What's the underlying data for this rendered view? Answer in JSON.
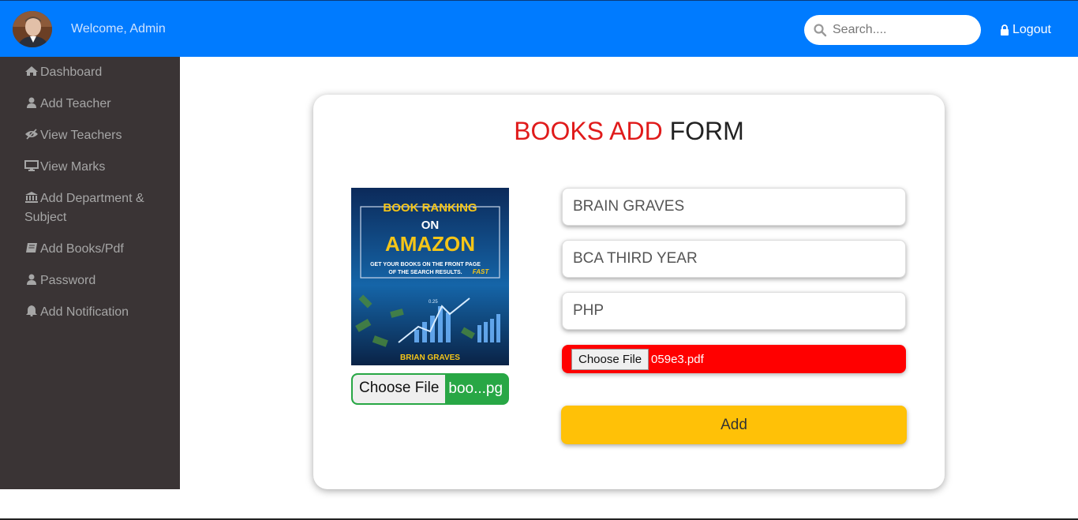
{
  "header": {
    "welcome": "Welcome, Admin",
    "search_placeholder": "Search....",
    "logout": "Logout"
  },
  "sidebar": {
    "items": [
      {
        "label": "Dashboard",
        "icon": "home-icon"
      },
      {
        "label": "Add Teacher",
        "icon": "user-icon"
      },
      {
        "label": "View Teachers",
        "icon": "eye-slash-icon"
      },
      {
        "label": "View Marks",
        "icon": "desktop-icon"
      },
      {
        "label": "Add Department & Subject",
        "icon": "university-icon"
      },
      {
        "label": "Add Books/Pdf",
        "icon": "book-icon"
      },
      {
        "label": "Password",
        "icon": "user-icon"
      },
      {
        "label": "Add Notification",
        "icon": "bell-icon"
      }
    ]
  },
  "form": {
    "title_part1": "BOOKS ADD",
    "title_part2": "FORM",
    "cover": {
      "title_line1": "BOOK RANKING",
      "title_line2": "ON",
      "title_line3": "AMAZON",
      "tagline1": "GET YOUR BOOKS ON THE FRONT PAGE",
      "tagline2": "OF THE SEARCH RESULTS.",
      "tagline_fast": "FAST",
      "author": "BRIAN GRAVES",
      "axis_label": "0.25"
    },
    "image_file": {
      "button": "Choose File",
      "filename": "boo...pg"
    },
    "fields": [
      {
        "value": "BRAIN GRAVES"
      },
      {
        "value": "BCA THIRD YEAR"
      },
      {
        "value": "PHP"
      }
    ],
    "pdf_file": {
      "button": "Choose File",
      "filename": "059e3.pdf"
    },
    "submit": "Add"
  },
  "colors": {
    "header": "#007bff",
    "sidebar": "#3a3435",
    "title_red": "#e01b1b",
    "image_file_bg": "#28a745",
    "pdf_file_bg": "#ff0000",
    "add_button": "#ffc107"
  }
}
